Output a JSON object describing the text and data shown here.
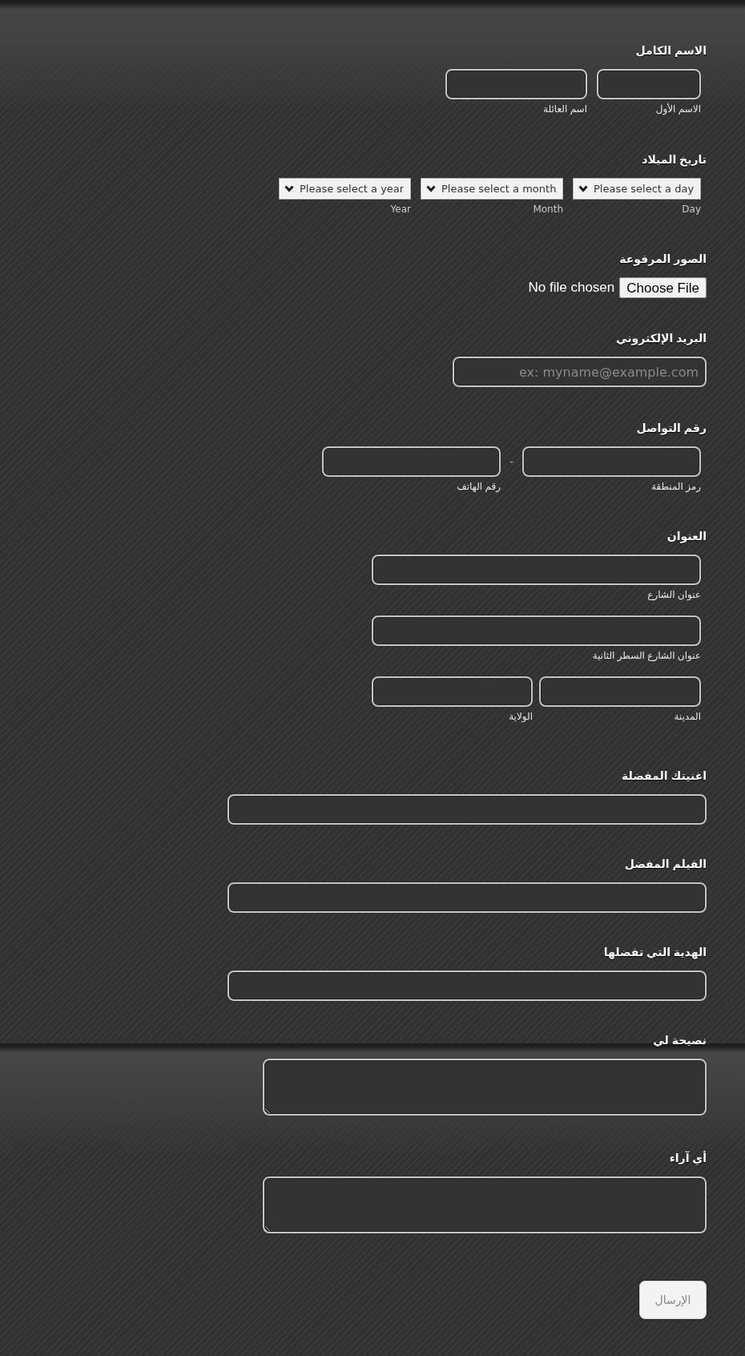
{
  "form": {
    "fields": [
      {
        "kind": "fullname",
        "label": "الاسم الكامل",
        "inputs": [
          {
            "sublabel": "الاسم الأول"
          },
          {
            "sublabel": "اسم العائلة"
          }
        ]
      },
      {
        "kind": "date",
        "label": "تاريخ الميلاد",
        "selects": [
          {
            "value": "Please select a day",
            "sublabel": "Day"
          },
          {
            "value": "Please select a month",
            "sublabel": "Month"
          },
          {
            "value": "Please select a year",
            "sublabel": "Year"
          }
        ]
      },
      {
        "kind": "file",
        "label": "الصور المرفوعة",
        "button": "Choose File",
        "status": "No file chosen"
      },
      {
        "kind": "email",
        "label": "البريد الإلكتروني",
        "placeholder": "ex: myname@example.com"
      },
      {
        "kind": "phone",
        "label": "رقم التواصل",
        "separator": "-",
        "inputs": [
          {
            "sublabel": "رمز المنطقة"
          },
          {
            "sublabel": "رقم الهاتف"
          }
        ]
      },
      {
        "kind": "address",
        "label": "العنوان",
        "lines": [
          [
            {
              "sublabel": "عنوان الشارع"
            }
          ],
          [
            {
              "sublabel": "عنوان الشارع السطر الثانية"
            }
          ],
          [
            {
              "sublabel": "المدينة"
            },
            {
              "sublabel": "الولاية"
            }
          ]
        ]
      },
      {
        "kind": "text",
        "label": "اغنيتك المفضلة"
      },
      {
        "kind": "text",
        "label": "الفيلم المفضل"
      },
      {
        "kind": "text",
        "label": "الهدية التي تفضلها"
      },
      {
        "kind": "textarea",
        "label": "نصيحة لي"
      },
      {
        "kind": "textarea",
        "label": "أي آراء"
      }
    ],
    "submit": {
      "label": "الإرسال",
      "disabled": true
    }
  }
}
